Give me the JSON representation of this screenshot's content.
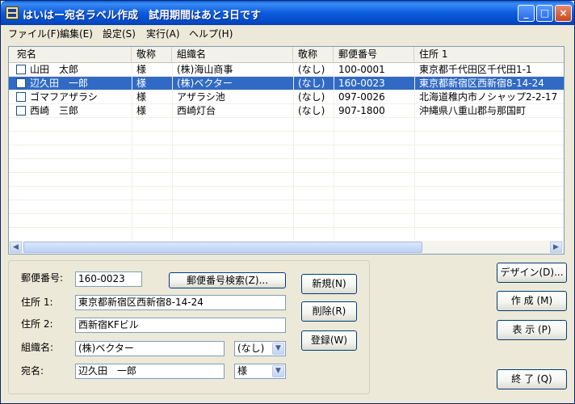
{
  "window": {
    "title": "はいはー宛名ラベル作成　試用期間はあと3日です",
    "minimize": "_",
    "maximize": "□",
    "close": "×"
  },
  "menu": [
    "ファイル(F)",
    "編集(E)",
    "設定(S)",
    "実行(A)",
    "ヘルプ(H)"
  ],
  "list": {
    "columns": [
      "宛名",
      "敬称",
      "組織名",
      "敬称",
      "郵便番号",
      "住所 1"
    ],
    "rows": [
      [
        "山田　太郎",
        "様",
        "(株)海山商事",
        "(なし)",
        "100-0001",
        "東京都千代田区千代田1-1"
      ],
      [
        "辺久田　一郎",
        "様",
        "(株)ベクター",
        "(なし)",
        "160-0023",
        "東京都新宿区西新宿8-14-24"
      ],
      [
        "ゴマフアザラシ",
        "様",
        "アザラシ池",
        "(なし)",
        "097-0026",
        "北海道稚内市ノシャップ2-2-17"
      ],
      [
        "西崎　三郎",
        "様",
        "西崎灯台",
        "(なし)",
        "907-1800",
        "沖縄県八重山郡与那国町"
      ]
    ],
    "selected_row": 1,
    "scroll_left": "◀",
    "scroll_right": "▶"
  },
  "form": {
    "postal_label": "郵便番号:",
    "postal_value": "160-0023",
    "postal_search_button": "郵便番号検索(Z)...",
    "address1_label": "住所 1:",
    "address1_value": "東京都新宿区西新宿8-14-24",
    "address2_label": "住所 2:",
    "address2_value": "西新宿KFビル",
    "org_label": "組織名:",
    "org_value": "(株)ベクター",
    "org_honorific": "(なし)",
    "name_label": "宛名:",
    "name_value": "辺久田　一郎",
    "name_honorific": "様",
    "dropdown_glyph": "▼"
  },
  "buttons": {
    "new": "新規(N)",
    "delete": "削除(R)",
    "register": "登録(W)",
    "design": "デザイン(D)...",
    "create": "作 成 (M)",
    "display": "表 示 (P)",
    "quit": "終 了 (Q)"
  },
  "colors": {
    "selection": "#316ac5",
    "titlebar": "#0b5cde",
    "face": "#ece9d8"
  }
}
